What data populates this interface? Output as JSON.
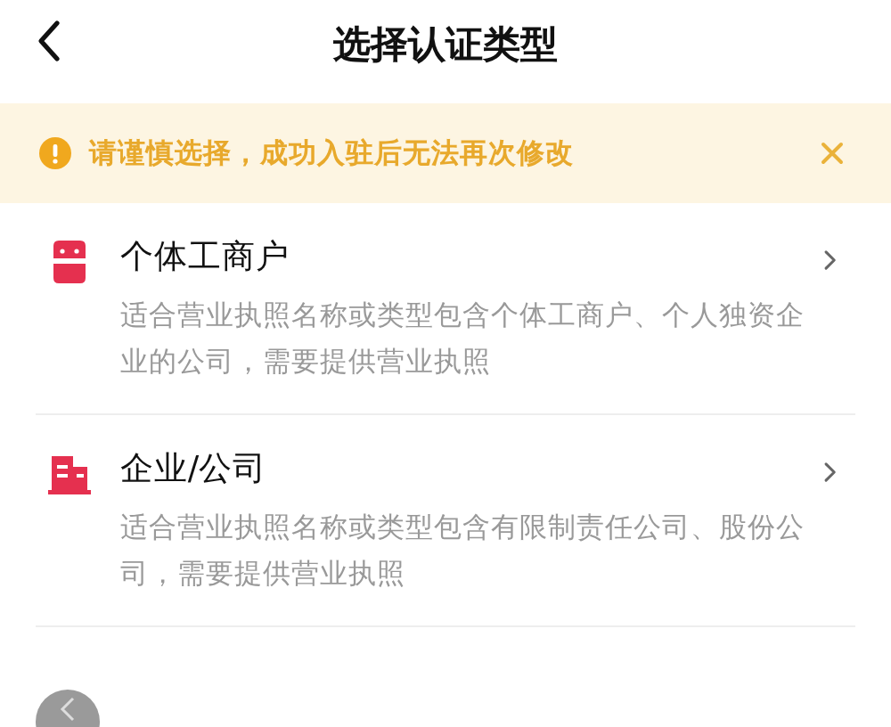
{
  "header": {
    "title": "选择认证类型"
  },
  "notice": {
    "text": "请谨慎选择，成功入驻后无法再次修改"
  },
  "options": [
    {
      "kind": "shop",
      "title": "个体工商户",
      "description": "适合营业执照名称或类型包含个体工商户、个人独资企业的公司，需要提供营业执照"
    },
    {
      "kind": "company",
      "title": "企业/公司",
      "description": "适合营业执照名称或类型包含有限制责任公司、股份公司，需要提供营业执照"
    }
  ]
}
